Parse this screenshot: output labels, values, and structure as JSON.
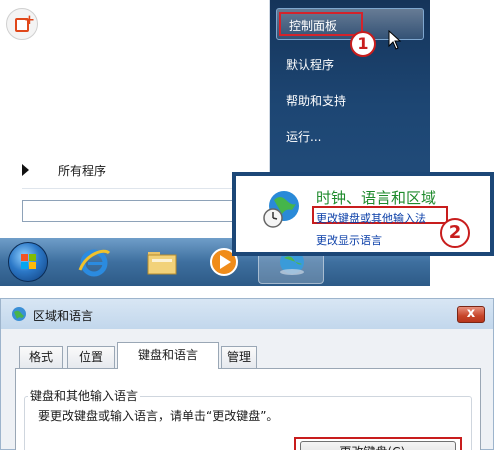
{
  "start_menu": {
    "all_programs": "所有程序",
    "right_items": [
      "控制面板",
      "默认程序",
      "帮助和支持",
      "运行..."
    ]
  },
  "annotations": {
    "step1": "1",
    "step2": "2"
  },
  "popup": {
    "title": "时钟、语言和区域",
    "link1": "更改键盘或其他输入法",
    "link2": "更改显示语言"
  },
  "dialog": {
    "title": "区域和语言",
    "close": "x",
    "tabs": [
      "格式",
      "位置",
      "键盘和语言",
      "管理"
    ],
    "active_tab": "键盘和语言",
    "group_label": "键盘和其他输入语言",
    "description": "要更改键盘或输入语言，请单击“更改键盘”。",
    "change_keyboard_button": "更改键盘(C)..."
  },
  "colors": {
    "highlight_red": "#c81d1d",
    "menu_blue": "#1d4673",
    "link_blue": "#0b3fa8",
    "title_green": "#1e8a2c"
  }
}
